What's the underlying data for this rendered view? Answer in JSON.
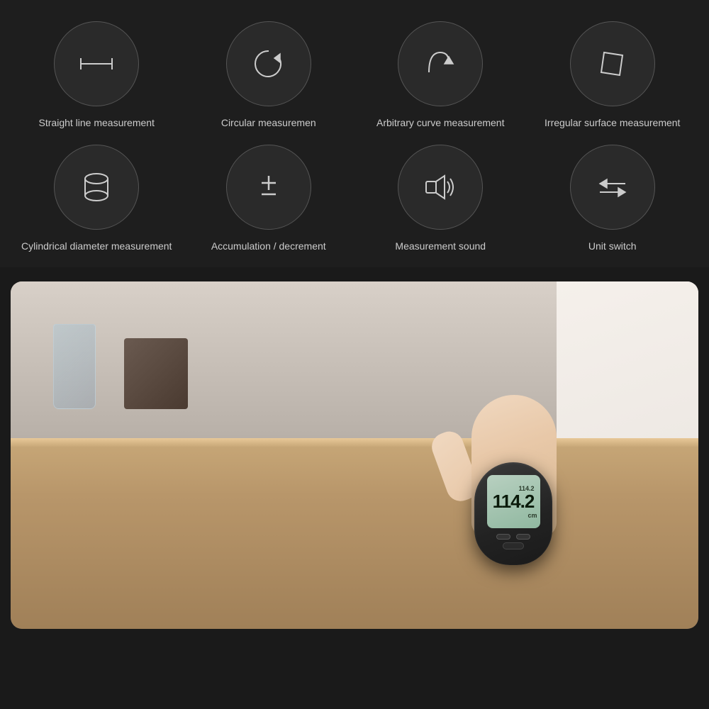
{
  "background": "#1e1e1e",
  "features": {
    "row1": [
      {
        "id": "straight-line",
        "label": "Straight line\nmeasurement",
        "icon": "straight-line"
      },
      {
        "id": "circular",
        "label": "Circular\nmeasuremen",
        "icon": "circular"
      },
      {
        "id": "arbitrary-curve",
        "label": "Arbitrary curve\nmeasurement",
        "icon": "arbitrary-curve"
      },
      {
        "id": "irregular-surface",
        "label": "Irregular surface\nmeasurement",
        "icon": "irregular-surface"
      }
    ],
    "row2": [
      {
        "id": "cylindrical",
        "label": "Cylindrical\ndiameter\nmeasurement",
        "icon": "cylindrical"
      },
      {
        "id": "accumulation",
        "label": "Accumulation /\ndecrement",
        "icon": "accumulation"
      },
      {
        "id": "measurement-sound",
        "label": "Measurement\nsound",
        "icon": "sound"
      },
      {
        "id": "unit-switch",
        "label": "Unit switch",
        "icon": "unit-switch"
      }
    ]
  },
  "device_display": {
    "small_number": "114.2",
    "main_number": "114.2",
    "unit": "cm"
  }
}
